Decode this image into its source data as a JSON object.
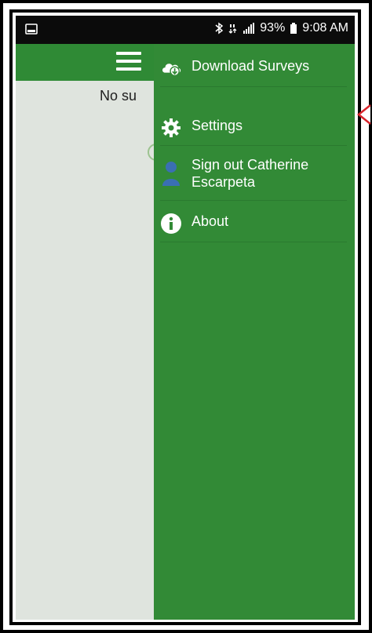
{
  "status_bar": {
    "battery": "93%",
    "time": "9:08 AM"
  },
  "main": {
    "empty_text": "No su"
  },
  "drawer": {
    "items": [
      {
        "label": "Download Surveys",
        "icon": "cloud-download-icon"
      },
      {
        "label": "Settings",
        "icon": "gear-icon"
      },
      {
        "label": "Sign out Catherine Escarpeta",
        "label_line1": "Sign out Catherine",
        "label_line2": "Escarpeta",
        "icon": "person-icon"
      },
      {
        "label": "About",
        "icon": "info-icon"
      }
    ]
  },
  "colors": {
    "brand_green": "#2f8a35",
    "drawer_green": "#328a36",
    "background_gray": "#dfe4de",
    "callout_red": "#d8232a",
    "avatar_blue": "#3a6fb3"
  }
}
